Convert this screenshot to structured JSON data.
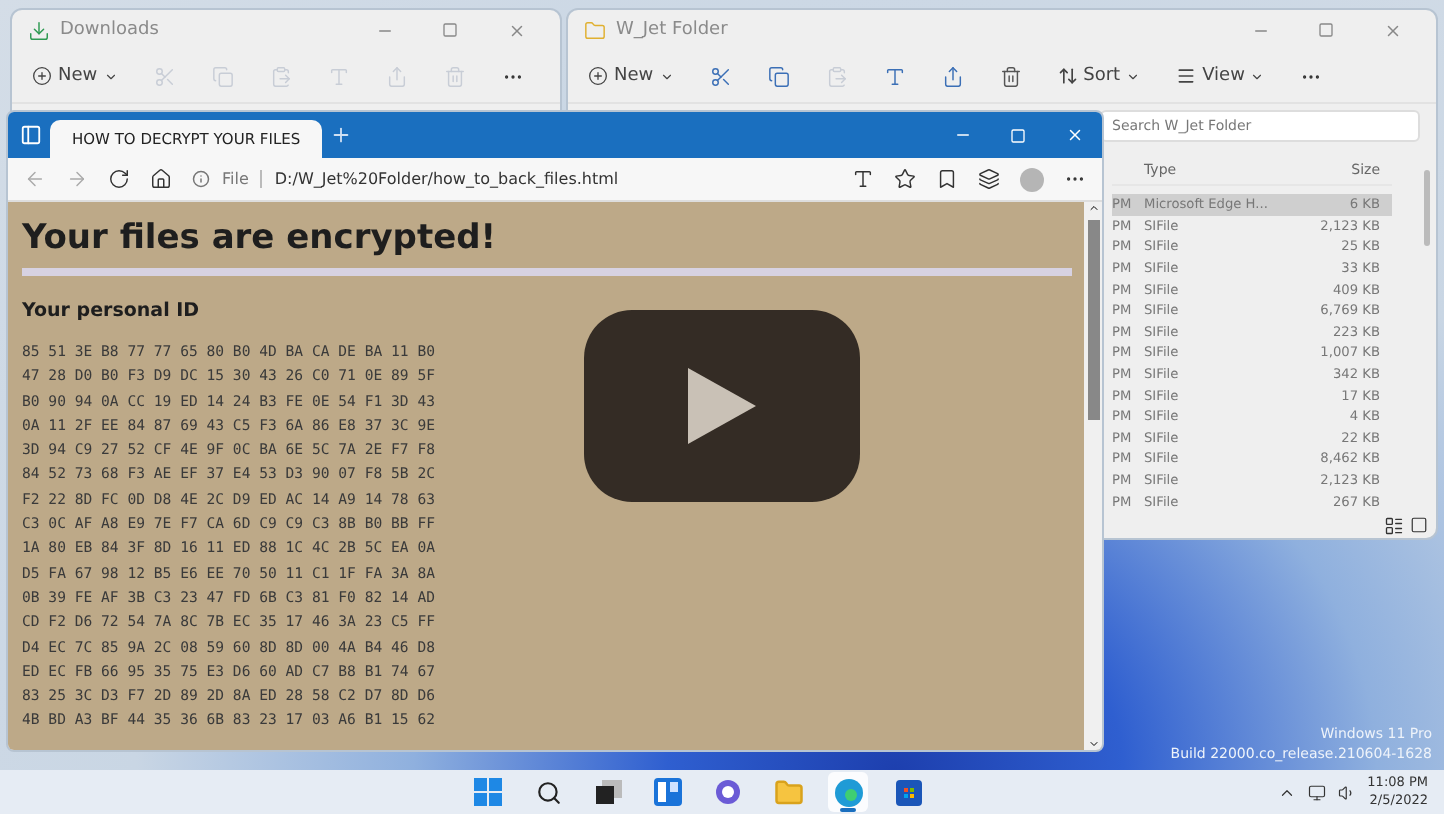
{
  "downloads_window": {
    "title": "Downloads",
    "new_button": "New"
  },
  "folder_window": {
    "title": "W_Jet Folder",
    "new_button": "New",
    "sort_button": "Sort",
    "view_button": "View",
    "search": {
      "placeholder": "Search W_Jet Folder"
    },
    "columns": [
      "Type",
      "Size"
    ],
    "rows": [
      {
        "column_1": "PM",
        "type": "Microsoft Edge H...",
        "size": "6 KB",
        "selected": true
      },
      {
        "column_1": "PM",
        "type": "SIFile",
        "size": "2,123 KB",
        "selected": false
      },
      {
        "column_1": "PM",
        "type": "SIFile",
        "size": "25 KB",
        "selected": false
      },
      {
        "column_1": "PM",
        "type": "SIFile",
        "size": "33 KB",
        "selected": false
      },
      {
        "column_1": "PM",
        "type": "SIFile",
        "size": "409 KB",
        "selected": false
      },
      {
        "column_1": "PM",
        "type": "SIFile",
        "size": "6,769 KB",
        "selected": false
      },
      {
        "column_1": "PM",
        "type": "SIFile",
        "size": "223 KB",
        "selected": false
      },
      {
        "column_1": "PM",
        "type": "SIFile",
        "size": "1,007 KB",
        "selected": false
      },
      {
        "column_1": "PM",
        "type": "SIFile",
        "size": "342 KB",
        "selected": false
      },
      {
        "column_1": "PM",
        "type": "SIFile",
        "size": "17 KB",
        "selected": false
      },
      {
        "column_1": "PM",
        "type": "SIFile",
        "size": "4 KB",
        "selected": false
      },
      {
        "column_1": "PM",
        "type": "SIFile",
        "size": "22 KB",
        "selected": false
      },
      {
        "column_1": "PM",
        "type": "SIFile",
        "size": "8,462 KB",
        "selected": false
      },
      {
        "column_1": "PM",
        "type": "SIFile",
        "size": "2,123 KB",
        "selected": false
      },
      {
        "column_1": "PM",
        "type": "SIFile",
        "size": "267 KB",
        "selected": false
      }
    ]
  },
  "browser": {
    "tab": {
      "title": "HOW TO DECRYPT YOUR FILES",
      "selected": true
    },
    "address": {
      "scheme": "File",
      "url": "D:/W_Jet%20Folder/how_to_back_files.html"
    },
    "page": {
      "heading": "Your files are encrypted!",
      "subheading": "Your personal ID",
      "id_lines": [
        "85 51 3E B8 77 77 65 80 B0 4D BA CA DE BA 11 B0",
        "47 28 D0 B0 F3 D9 DC 15 30 43 26 C0 71 0E 89 5F",
        "B0 90 94 0A CC 19 ED 14 24 B3 FE 0E 54 F1 3D 43",
        "0A 11 2F EE 84 87 69 43 C5 F3 6A 86 E8 37 3C 9E",
        "3D 94 C9 27 52 CF 4E 9F 0C BA 6E 5C 7A 2E F7 F8",
        "84 52 73 68 F3 AE EF 37 E4 53 D3 90 07 F8 5B 2C",
        "F2 22 8D FC 0D D8 4E 2C D9 ED AC 14 A9 14 78 63",
        "C3 0C AF A8 E9 7E F7 CA 6D C9 C9 C3 8B B0 BB FF",
        "1A 80 EB 84 3F 8D 16 11 ED 88 1C 4C 2B 5C EA 0A",
        "D5 FA 67 98 12 B5 E6 EE 70 50 11 C1 1F FA 3A 8A",
        "0B 39 FE AF 3B C3 23 47 FD 6B C3 81 F0 82 14 AD",
        "CD F2 D6 72 54 7A 8C 7B EC 35 17 46 3A 23 C5 FF",
        "D4 EC 7C 85 9A 2C 08 59 60 8D 8D 00 4A B4 46 D8",
        "ED EC FB 66 95 35 75 E3 D6 60 AD C7 B8 B1 74 67",
        "83 25 3C D3 F7 2D 89 2D 8A ED 28 58 C2 D7 8D D6",
        "4B BD A3 BF 44 35 36 6B 83 23 17 03 A6 B1 15 62"
      ]
    }
  },
  "desktop": {
    "edition": "Windows 11 Pro",
    "build": "Build 22000.co_release.210604-1628"
  },
  "taskbar": {
    "apps": [
      {
        "kind": "start",
        "selected": false
      },
      {
        "kind": "search",
        "selected": false
      },
      {
        "kind": "taskview",
        "selected": false
      },
      {
        "kind": "widgets",
        "selected": false
      },
      {
        "kind": "chat",
        "selected": false
      },
      {
        "kind": "explorer",
        "selected": false
      },
      {
        "kind": "edge",
        "selected": true
      },
      {
        "kind": "store",
        "selected": false
      }
    ],
    "time": "11:08 PM",
    "date": "2/5/2022"
  }
}
